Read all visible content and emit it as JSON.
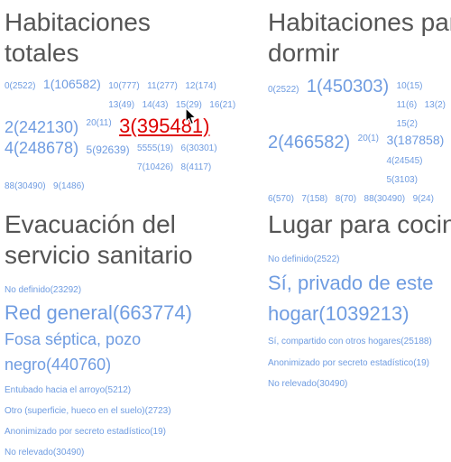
{
  "panels": [
    {
      "title_line1": "Habitaciones",
      "title_line2": "totales",
      "tags": [
        {
          "label": "0(2522)",
          "size": 10
        },
        {
          "label": "1(106582)",
          "size": 14
        },
        {
          "label": "10(777)",
          "size": 10
        },
        {
          "label": "11(277)",
          "size": 10
        },
        {
          "label": "12(174)",
          "size": 10
        },
        {
          "label": "13(49)",
          "size": 10
        },
        {
          "label": "14(43)",
          "size": 10
        },
        {
          "label": "15(29)",
          "size": 10
        },
        {
          "label": "16(21)",
          "size": 10
        },
        {
          "label": "2(242130)",
          "size": 18
        },
        {
          "label": "20(11)",
          "size": 10
        },
        {
          "label": "3(395481)",
          "size": 22
        },
        {
          "label": "4(248678)",
          "size": 18
        },
        {
          "label": "5(92639)",
          "size": 12
        },
        {
          "label": "5555(19)",
          "size": 10
        },
        {
          "label": "6(30301)",
          "size": 10
        },
        {
          "label": "7(10426)",
          "size": 10
        },
        {
          "label": "8(4117)",
          "size": 10
        },
        {
          "label": "88(30490)",
          "size": 10
        },
        {
          "label": "9(1486)",
          "size": 10
        }
      ]
    },
    {
      "title_line1": "Habitaciones para",
      "title_line2": "dormir",
      "tags": [
        {
          "label": "0(2522)",
          "size": 10
        },
        {
          "label": "1(450303)",
          "size": 20
        },
        {
          "label": "10(15)",
          "size": 10
        },
        {
          "label": "11(6)",
          "size": 10
        },
        {
          "label": "13(2)",
          "size": 10
        },
        {
          "label": "15(2)",
          "size": 10
        },
        {
          "label": "2(466582)",
          "size": 20
        },
        {
          "label": "20(1)",
          "size": 10
        },
        {
          "label": "3(187858)",
          "size": 14
        },
        {
          "label": "4(24545)",
          "size": 10
        },
        {
          "label": "5(3103)",
          "size": 10
        },
        {
          "label": "6(570)",
          "size": 10
        },
        {
          "label": "7(158)",
          "size": 10
        },
        {
          "label": "8(70)",
          "size": 10
        },
        {
          "label": "88(30490)",
          "size": 10
        },
        {
          "label": "9(24)",
          "size": 10
        }
      ]
    },
    {
      "title_line1": "Evacuación del",
      "title_line2": "servicio sanitario",
      "tags": [
        {
          "label": "No definido(23292)",
          "size": 10
        },
        {
          "label": "Red general(663774)",
          "size": 22
        },
        {
          "label": "Fosa séptica, pozo negro(440760)",
          "size": 18
        },
        {
          "label": "Entubado hacia el arroyo(5212)",
          "size": 10
        },
        {
          "label": "Otro (superficie, hueco en el suelo)(2723)",
          "size": 10
        },
        {
          "label": "Anonimizado por secreto estadístico(19)",
          "size": 10
        },
        {
          "label": "No relevado(30490)",
          "size": 10
        }
      ]
    },
    {
      "title_line1": "Lugar para cocinar",
      "title_line2": "",
      "tags": [
        {
          "label": "No definido(2522)",
          "size": 10
        },
        {
          "label": "Sí, privado de este hogar(1039213)",
          "size": 22
        },
        {
          "label": "Sí, compartido con otros hogares(25188)",
          "size": 10
        },
        {
          "label": "Anonimizado por secreto estadístico(19)",
          "size": 10
        },
        {
          "label": "No relevado(30490)",
          "size": 10
        }
      ]
    }
  ],
  "colors": {
    "link": "#6f9ce1",
    "hover": "#dd0000",
    "title": "#555555"
  },
  "cursor_icon": "arrow-cursor-icon"
}
